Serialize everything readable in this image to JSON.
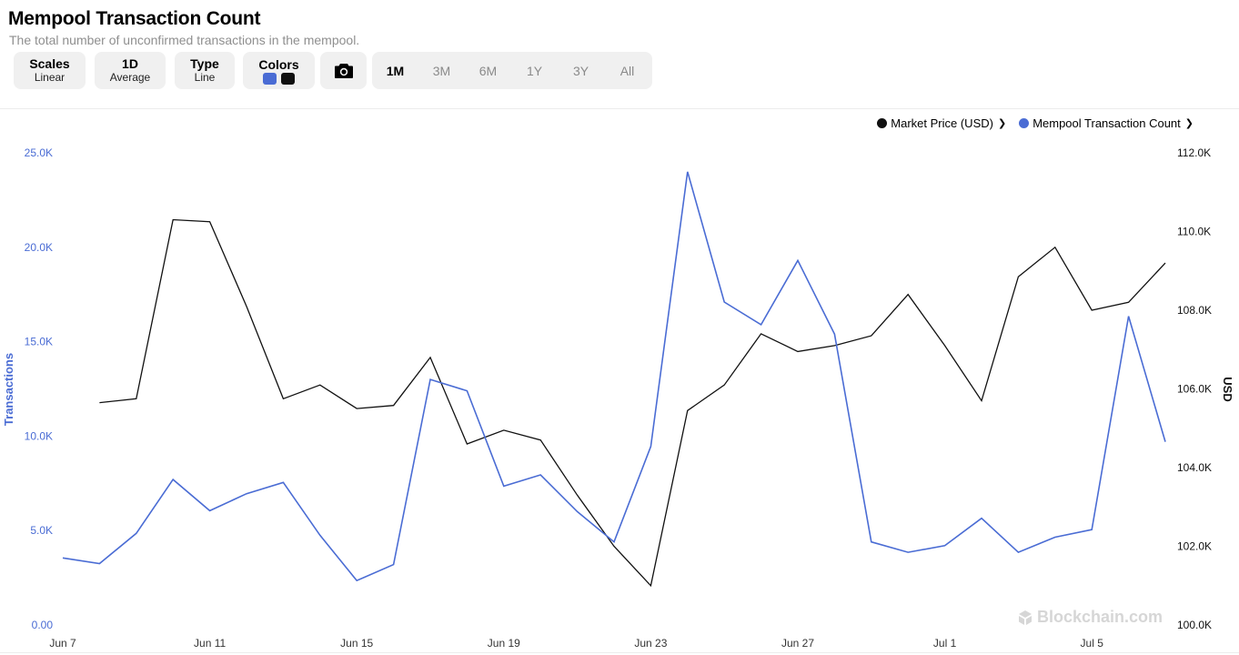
{
  "header": {
    "title": "Mempool Transaction Count",
    "subtitle": "The total number of unconfirmed transactions in the mempool."
  },
  "toolbar": {
    "scales_label": "Scales",
    "scales_value": "Linear",
    "interval_label": "1D",
    "interval_value": "Average",
    "type_label": "Type",
    "type_value": "Line",
    "colors_label": "Colors",
    "camera_icon": "camera-icon",
    "ranges": [
      {
        "label": "1M",
        "active": true
      },
      {
        "label": "3M",
        "active": false
      },
      {
        "label": "6M",
        "active": false
      },
      {
        "label": "1Y",
        "active": false
      },
      {
        "label": "3Y",
        "active": false
      },
      {
        "label": "All",
        "active": false
      }
    ]
  },
  "watermark": "Blockchain.com",
  "chart_data": {
    "type": "line",
    "x": [
      "Jun 7",
      "Jun 8",
      "Jun 9",
      "Jun 10",
      "Jun 11",
      "Jun 12",
      "Jun 13",
      "Jun 14",
      "Jun 15",
      "Jun 16",
      "Jun 17",
      "Jun 18",
      "Jun 19",
      "Jun 20",
      "Jun 21",
      "Jun 22",
      "Jun 23",
      "Jun 24",
      "Jun 25",
      "Jun 26",
      "Jun 27",
      "Jun 28",
      "Jun 29",
      "Jun 30",
      "Jul 1",
      "Jul 2",
      "Jul 3",
      "Jul 4",
      "Jul 5",
      "Jul 6",
      "Jul 7"
    ],
    "x_tick_labels": [
      "Jun 7",
      "Jun 11",
      "Jun 15",
      "Jun 19",
      "Jun 23",
      "Jun 27",
      "Jul 1",
      "Jul 5"
    ],
    "series": [
      {
        "name": "Mempool Transaction Count",
        "axis": "left",
        "color": "#4a6cd4",
        "values": [
          3550,
          3250,
          4850,
          7700,
          6050,
          6950,
          7550,
          4750,
          2350,
          3200,
          13000,
          12400,
          7350,
          7950,
          6000,
          4400,
          9450,
          24000,
          17100,
          15900,
          19300,
          15400,
          4400,
          3850,
          4200,
          5650,
          3850,
          4650,
          5050,
          16350,
          9700
        ]
      },
      {
        "name": "Market Price (USD)",
        "axis": "right",
        "color": "#111111",
        "values": [
          null,
          105650,
          105750,
          110300,
          110250,
          108100,
          105750,
          106100,
          105500,
          105580,
          106800,
          104600,
          104950,
          104700,
          103300,
          102000,
          101000,
          105450,
          106100,
          107400,
          106950,
          107100,
          107350,
          108400,
          107100,
          105700,
          108850,
          109600,
          108000,
          108200,
          109200
        ]
      }
    ],
    "y_left": {
      "label": "Transactions",
      "ticks": [
        "0.00",
        "5.0K",
        "10.0K",
        "15.0K",
        "20.0K",
        "25.0K"
      ],
      "min": 0,
      "max": 25000
    },
    "y_right": {
      "label": "USD",
      "ticks": [
        "100.0K",
        "102.0K",
        "104.0K",
        "106.0K",
        "108.0K",
        "110.0K",
        "112.0K"
      ],
      "min": 100000,
      "max": 112000
    },
    "legend_position": "top-right",
    "grid": false
  }
}
